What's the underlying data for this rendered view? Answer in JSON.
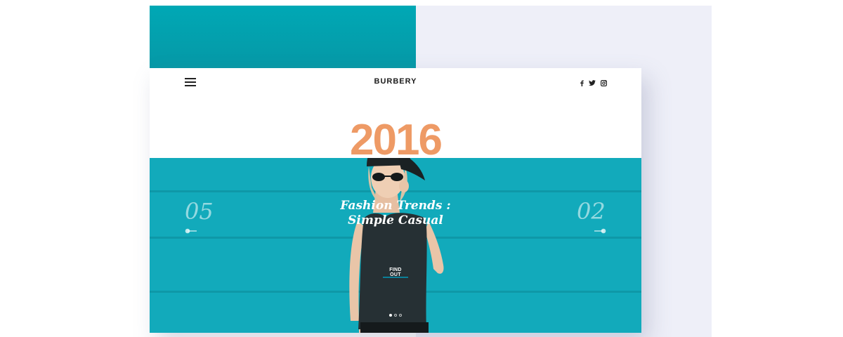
{
  "brand": {
    "name": "BURBERY"
  },
  "icons": {
    "menu": "menu-icon",
    "social": [
      "facebook-icon",
      "twitter-icon",
      "instagram-icon"
    ]
  },
  "hero": {
    "year": "2016",
    "headline_line1": "Fashion Trends :",
    "headline_line2": "Simple Casual",
    "cta_label": "FIND OUT",
    "prev_number": "05",
    "next_number": "02",
    "carousel": {
      "count": 3,
      "active": 0
    }
  },
  "colors": {
    "accent_orange": "#ee9a65",
    "teal": "#12aabb",
    "background_lavender": "#eeeff8"
  }
}
